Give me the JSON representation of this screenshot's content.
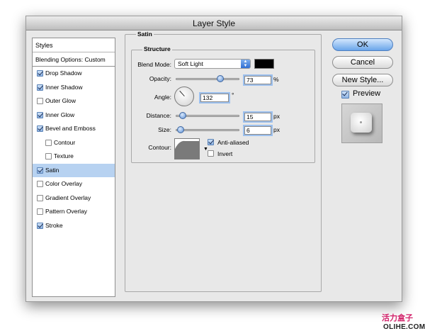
{
  "dialog": {
    "title": "Layer Style"
  },
  "styles_panel": {
    "header": "Styles",
    "blending_options": "Blending Options: Custom",
    "items": [
      {
        "label": "Drop Shadow",
        "checked": true,
        "indent": false,
        "selected": false
      },
      {
        "label": "Inner Shadow",
        "checked": true,
        "indent": false,
        "selected": false
      },
      {
        "label": "Outer Glow",
        "checked": false,
        "indent": false,
        "selected": false
      },
      {
        "label": "Inner Glow",
        "checked": true,
        "indent": false,
        "selected": false
      },
      {
        "label": "Bevel and Emboss",
        "checked": true,
        "indent": false,
        "selected": false
      },
      {
        "label": "Contour",
        "checked": false,
        "indent": true,
        "selected": false
      },
      {
        "label": "Texture",
        "checked": false,
        "indent": true,
        "selected": false
      },
      {
        "label": "Satin",
        "checked": true,
        "indent": false,
        "selected": true
      },
      {
        "label": "Color Overlay",
        "checked": false,
        "indent": false,
        "selected": false
      },
      {
        "label": "Gradient Overlay",
        "checked": false,
        "indent": false,
        "selected": false
      },
      {
        "label": "Pattern Overlay",
        "checked": false,
        "indent": false,
        "selected": false
      },
      {
        "label": "Stroke",
        "checked": true,
        "indent": false,
        "selected": false
      }
    ]
  },
  "satin": {
    "legend": "Satin",
    "structure_legend": "Structure",
    "blend_mode_label": "Blend Mode:",
    "blend_mode_value": "Soft Light",
    "blend_color": "#000000",
    "opacity_label": "Opacity:",
    "opacity_value": "73",
    "opacity_unit": "%",
    "opacity_fraction": 0.73,
    "angle_label": "Angle:",
    "angle_value": "132",
    "angle_unit": "°",
    "distance_label": "Distance:",
    "distance_value": "15",
    "distance_unit": "px",
    "distance_fraction": 0.06,
    "size_label": "Size:",
    "size_value": "6",
    "size_unit": "px",
    "size_fraction": 0.03,
    "contour_label": "Contour:",
    "anti_aliased_label": "Anti-aliased",
    "anti_aliased_checked": true,
    "invert_label": "Invert",
    "invert_checked": false
  },
  "buttons": {
    "ok": "OK",
    "cancel": "Cancel",
    "new_style": "New Style...",
    "preview_label": "Preview",
    "preview_checked": true
  },
  "watermark": {
    "chinese": "活力盒子",
    "latin": "OLIHE.COM"
  }
}
